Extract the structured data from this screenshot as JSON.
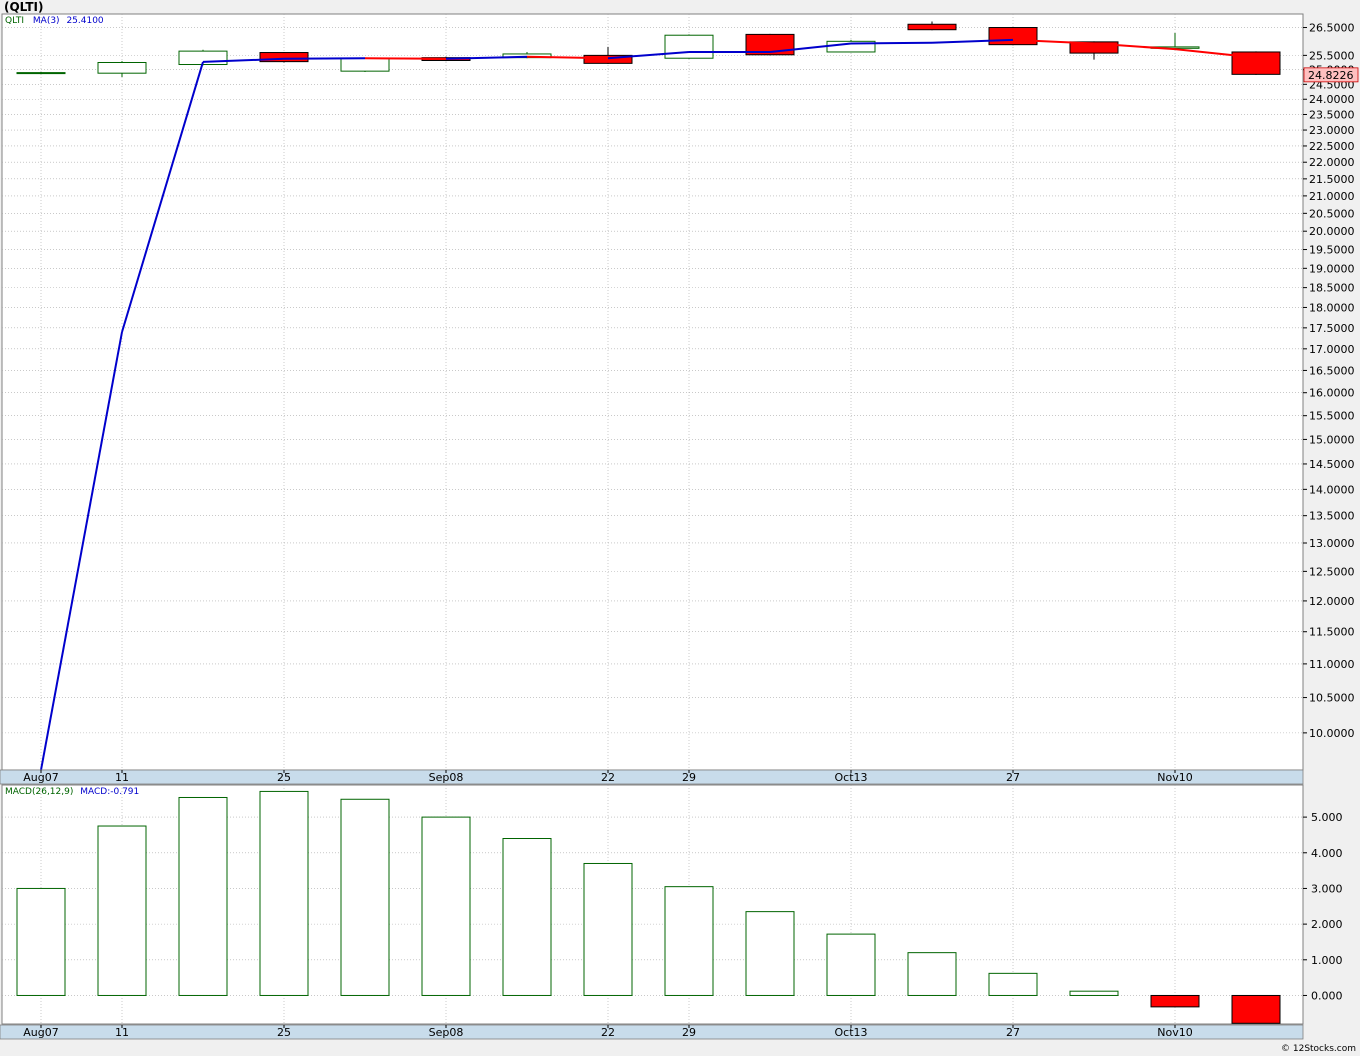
{
  "title": "(QLTI)",
  "copyright": "© 12Stocks.com",
  "price_legend": {
    "symbol": "QLTI",
    "ma_label": "MA(3)",
    "ma_value": "25.4100"
  },
  "macd_legend": {
    "label": "MACD(26,12,9)",
    "value_label": "MACD:-0.791"
  },
  "last_price_label": "24.8226",
  "colors": {
    "up": "#006400",
    "down": "#ff0000",
    "ma_line": "#0000cc",
    "ma_line_down": "#ff0000",
    "grid": "#a9a9a9",
    "axis_bar": "#c8dceb",
    "plot_bg": "#ffffff",
    "last_label_bg": "#ffc0c0"
  },
  "chart_data": [
    {
      "type": "candlestick",
      "title": "(QLTI)",
      "ylim": [
        9.5,
        27.0
      ],
      "y_scale": "log",
      "y_ticks": [
        "10.0000",
        "10.5000",
        "11.0000",
        "11.5000",
        "12.0000",
        "12.5000",
        "13.0000",
        "13.5000",
        "14.0000",
        "14.5000",
        "15.0000",
        "15.5000",
        "16.0000",
        "16.5000",
        "17.0000",
        "17.5000",
        "18.0000",
        "18.5000",
        "19.0000",
        "19.5000",
        "20.0000",
        "20.5000",
        "21.0000",
        "21.5000",
        "22.0000",
        "22.5000",
        "23.0000",
        "23.5000",
        "24.0000",
        "24.5000",
        "25.0000",
        "25.5000",
        "26.5000"
      ],
      "x_labels": [
        {
          "index": 0,
          "text": "Aug07"
        },
        {
          "index": 1,
          "text": "11"
        },
        {
          "index": 3,
          "text": "25"
        },
        {
          "index": 5,
          "text": "Sep08"
        },
        {
          "index": 7,
          "text": "22"
        },
        {
          "index": 8,
          "text": "29"
        },
        {
          "index": 10,
          "text": "Oct13"
        },
        {
          "index": 12,
          "text": "27"
        },
        {
          "index": 14,
          "text": "Nov10"
        }
      ],
      "candles": [
        {
          "open": 24.9,
          "high": 24.92,
          "low": 24.88,
          "close": 24.9
        },
        {
          "open": 24.88,
          "high": 25.3,
          "low": 24.75,
          "close": 25.25
        },
        {
          "open": 25.18,
          "high": 25.7,
          "low": 25.15,
          "close": 25.65
        },
        {
          "open": 25.6,
          "high": 25.62,
          "low": 25.25,
          "close": 25.28
        },
        {
          "open": 24.95,
          "high": 25.42,
          "low": 24.92,
          "close": 25.4
        },
        {
          "open": 25.42,
          "high": 25.45,
          "low": 25.3,
          "close": 25.32
        },
        {
          "open": 25.42,
          "high": 25.62,
          "low": 25.4,
          "close": 25.55
        },
        {
          "open": 25.5,
          "high": 25.8,
          "low": 25.2,
          "close": 25.22
        },
        {
          "open": 25.4,
          "high": 26.25,
          "low": 25.38,
          "close": 26.22
        },
        {
          "open": 26.25,
          "high": 26.27,
          "low": 25.5,
          "close": 25.52
        },
        {
          "open": 25.62,
          "high": 26.05,
          "low": 25.6,
          "close": 26.0
        },
        {
          "open": 26.62,
          "high": 26.72,
          "low": 26.4,
          "close": 26.42
        },
        {
          "open": 26.5,
          "high": 26.52,
          "low": 25.86,
          "close": 25.88
        },
        {
          "open": 25.98,
          "high": 26.0,
          "low": 25.35,
          "close": 25.58
        },
        {
          "open": 25.75,
          "high": 26.3,
          "low": 25.72,
          "close": 25.8
        },
        {
          "open": 25.62,
          "high": 25.64,
          "low": 24.82,
          "close": 24.84
        }
      ],
      "ma_series": {
        "name": "MA(3)",
        "values": [
          9.4,
          17.4,
          25.27,
          25.38,
          25.4,
          25.38,
          25.45,
          25.4,
          25.62,
          25.62,
          25.92,
          25.95,
          26.05,
          25.92,
          25.72,
          25.42
        ]
      }
    },
    {
      "type": "bar",
      "title": "MACD(26,12,9)",
      "ylim": [
        -0.8,
        5.9
      ],
      "y_ticks": [
        "0.000",
        "1.000",
        "2.000",
        "3.000",
        "4.000",
        "5.000"
      ],
      "values": [
        3.0,
        4.75,
        5.55,
        5.72,
        5.5,
        5.0,
        4.4,
        3.7,
        3.05,
        2.35,
        1.72,
        1.2,
        0.62,
        0.12,
        -0.32,
        -0.78
      ]
    }
  ]
}
